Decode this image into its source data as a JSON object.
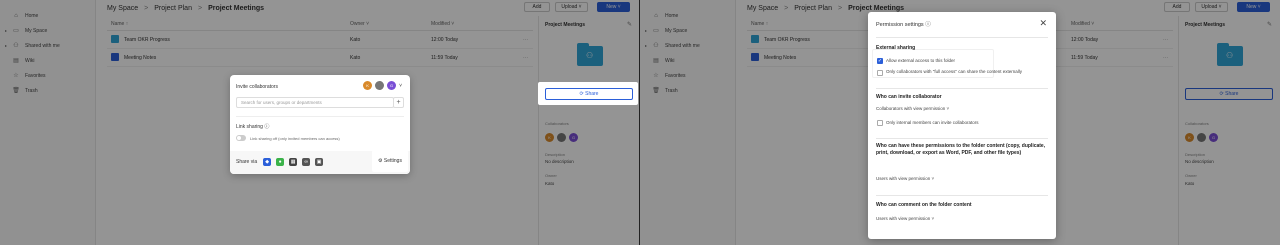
{
  "left": {
    "sidebar": {
      "items": [
        {
          "label": "Home",
          "icon": "home-icon",
          "glyph": "⌂"
        },
        {
          "label": "My Space",
          "icon": "folder-icon",
          "glyph": "▭",
          "caret": "▸"
        },
        {
          "label": "Shared with me",
          "icon": "users-icon",
          "glyph": "⚇",
          "caret": "▸"
        },
        {
          "label": "Wiki",
          "icon": "book-icon",
          "glyph": "▤"
        },
        {
          "label": "Favorites",
          "icon": "star-icon",
          "glyph": "☆"
        },
        {
          "label": "Trash",
          "icon": "trash-icon",
          "glyph": "🗑"
        }
      ]
    },
    "breadcrumb": [
      "My Space",
      "Project Plan",
      "Project Meetings"
    ],
    "breadcrumb_sep": ">",
    "buttons": {
      "add": "Add",
      "upload": "Upload ˅",
      "new": "New ˅"
    },
    "table": {
      "columns": {
        "name": "Name ↑",
        "owner": "Owner ˅",
        "modified": "Modified ˅"
      },
      "rows": [
        {
          "name": "Team OKR Progress",
          "owner": "Kato",
          "modified": "12:00 Today",
          "icon_color": "#2fa6d8",
          "more": "···"
        },
        {
          "name": "Meeting Notes",
          "owner": "Kato",
          "modified": "11:59 Today",
          "icon_color": "#2b5fd9",
          "more": "···"
        }
      ]
    },
    "detail": {
      "title": "Project Meetings",
      "edit": "✎",
      "share": "⟳ Share",
      "collaborators_label": "Collaborators",
      "collaborators": [
        {
          "initial": "K",
          "color": "#d98a2b"
        },
        {
          "initial": "",
          "color": "#777"
        },
        {
          "initial": "G",
          "color": "#7a4fd6"
        }
      ],
      "description_label": "Description",
      "description": "No description",
      "owner_label": "Owner",
      "owner": "Kato"
    },
    "invite": {
      "title": "Invite collaborators",
      "avatars": [
        {
          "initial": "K",
          "color": "#d98a2b"
        },
        {
          "initial": "",
          "color": "#777"
        },
        {
          "initial": "G",
          "color": "#7a4fd6"
        }
      ],
      "avatars_caret": "˅",
      "search_placeholder": "Search for users, groups or departments",
      "add": "+",
      "link_sharing": "Link sharing ⓘ",
      "link_status": "Link sharing off (only invited members can access)",
      "share_via": "Share via",
      "share_icons": [
        {
          "name": "lark-icon",
          "glyph": "◆",
          "color": "#2b5fd9"
        },
        {
          "name": "wechat-icon",
          "glyph": "●",
          "color": "#3bb34a"
        },
        {
          "name": "qr-code-icon",
          "glyph": "▦",
          "color": "#444"
        },
        {
          "name": "link-icon",
          "glyph": "∞",
          "color": "#555"
        },
        {
          "name": "image-icon",
          "glyph": "▣",
          "color": "#555"
        }
      ],
      "settings": "⚙ Settings"
    }
  },
  "right": {
    "modal": {
      "title": "Permission settings ⓘ",
      "close": "✕",
      "external_sharing": "External sharing",
      "allow_external": "Allow external access to this folder",
      "full_access_only": "Only collaborators with \"full access\" can share the content externally",
      "who_invite": "Who can invite collaborator",
      "invite_value": "Collaborators with view permission ˅",
      "internal_only": "Only internal members can invite collaborators",
      "who_permissions": "Who can have these permissions to the folder content (copy, duplicate, print, download, or export as Word, PDF, and other file types)",
      "permissions_value": "Users with view permission ˅",
      "who_comment": "Who can comment on the folder content",
      "comment_value": "Users with view permission ˅",
      "checkmark": "✓"
    }
  }
}
